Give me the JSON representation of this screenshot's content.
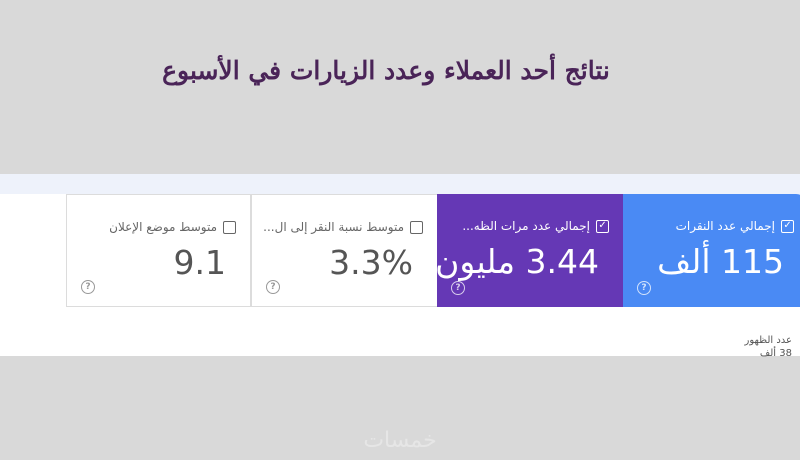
{
  "headline": "نتائج أحد العملاء وعدد الزيارات في الأسبوع",
  "metrics": [
    {
      "label": "إجمالي عدد النقرات",
      "value": "115 ألف",
      "checked": true
    },
    {
      "label": "إجمالي عدد مرات الظه...",
      "value": "3.44 مليون",
      "checked": true
    },
    {
      "label": "متوسط نسبة النقر إلى ال...",
      "value": "3.3%",
      "checked": false
    },
    {
      "label": "متوسط موضع الإعلان",
      "value": "9.1",
      "checked": false
    }
  ],
  "side_label": "عدد الظهور",
  "side_value": "38 ألف",
  "help_glyph": "?",
  "check_glyph": "✓",
  "watermark": "خمسات",
  "colors": {
    "clicks": "#4a8af4",
    "impressions": "#6538b5",
    "headline": "#4a2458"
  }
}
